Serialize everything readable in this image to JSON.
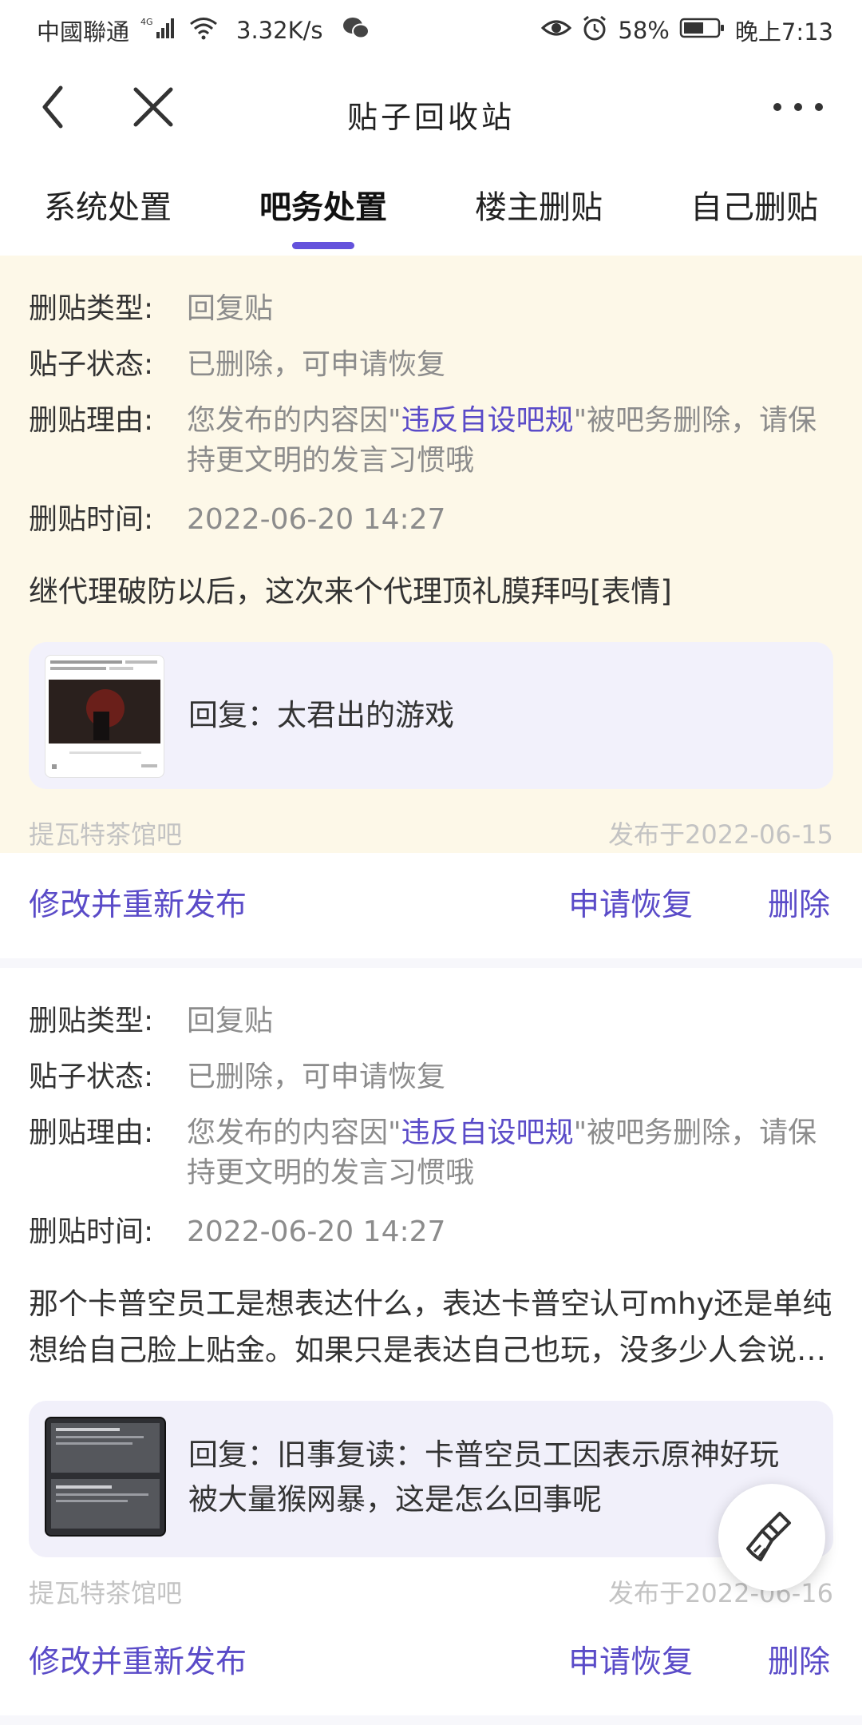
{
  "status_bar": {
    "carrier": "中國聯通",
    "network": "4G",
    "speed": "3.32K/s",
    "battery": "58%",
    "time": "晚上7:13"
  },
  "header": {
    "title": "贴子回收站",
    "back_icon": "back-arrow-icon",
    "close_icon": "close-icon",
    "more_icon": "more-dots-icon"
  },
  "tabs": [
    {
      "label": "系统处置",
      "active": false
    },
    {
      "label": "吧务处置",
      "active": true
    },
    {
      "label": "楼主删贴",
      "active": false
    },
    {
      "label": "自己删贴",
      "active": false
    }
  ],
  "labels": {
    "type": "删贴类型:",
    "status": "贴子状态:",
    "reason": "删贴理由:",
    "time": "删贴时间:"
  },
  "posts": [
    {
      "type": "回复贴",
      "status": "已删除，可申请恢复",
      "reason_prefix": "您发布的内容因\"",
      "reason_rule": "违反自设吧规",
      "reason_suffix": "\"被吧务删除，请保持更文明的发言习惯哦",
      "time": "2022-06-20 14:27",
      "content": "继代理破防以后，这次来个代理顶礼膜拜吗[表情]",
      "reply": "回复：太君出的游戏",
      "forum": "提瓦特茶馆吧",
      "published": "发布于2022-06-15"
    },
    {
      "type": "回复贴",
      "status": "已删除，可申请恢复",
      "reason_prefix": "您发布的内容因\"",
      "reason_rule": "违反自设吧规",
      "reason_suffix": "\"被吧务删除，请保持更文明的发言习惯哦",
      "time": "2022-06-20 14:27",
      "content": "那个卡普空员工是想表达什么，表达卡普空认可mhy还是单纯想给自己脸上贴金。如果只是表达自己也玩，没多少人会说什么吧",
      "reply": "回复：旧事复读：卡普空员工因表示原神好玩被大量猴网暴，这是怎么回事呢",
      "forum": "提瓦特茶馆吧",
      "published": "发布于2022-06-16"
    }
  ],
  "actions": {
    "edit": "修改并重新发布",
    "restore": "申请恢复",
    "delete": "删除"
  },
  "fab_icon": "broom-icon",
  "colors": {
    "accent": "#5a4bc8",
    "card_highlight": "#fdf8e8",
    "reply_bg": "#f1f0fa"
  }
}
